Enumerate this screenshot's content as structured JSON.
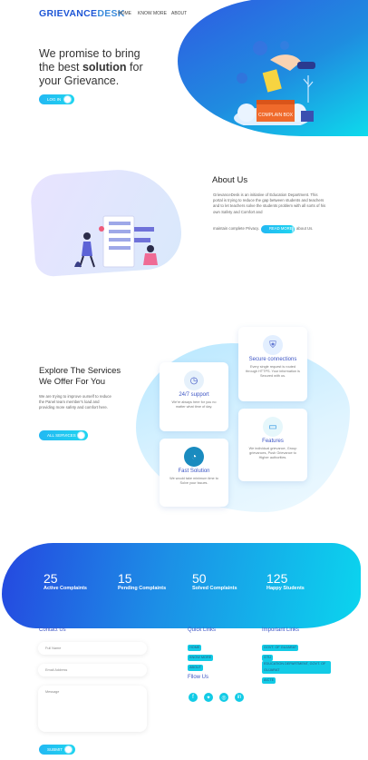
{
  "nav": {
    "logo_part1": "GRIEVANCE",
    "logo_part2": "DESK",
    "home": "HOME",
    "know_more": "KNOW MORE",
    "about": "ABOUT"
  },
  "hero": {
    "line1": "We promise to bring",
    "line2_pre": "the best ",
    "line2_bold": "solution",
    "line2_post": " for",
    "line3": "your Grievance.",
    "login": "LOG IN",
    "box_label": "COMPLAIN BOX"
  },
  "about": {
    "title": "About Us",
    "text": "GrievanceDesk is an initiative of Education Department. This portal is trying to reduce the gap between students and teachers and to let teachers solve the students problem with all sorts of his own Safety and Comfort and",
    "text2_pre": "maintain complete Privacy.",
    "read_more": "READ MORE",
    "text2_post": "about Us."
  },
  "services": {
    "title_line1": "Explore The Services",
    "title_line2": "We Offer For You",
    "desc": "We are trying to improve ourself to reduce the Panel team member's load and providing more safety and comfort here.",
    "all_services": "ALL SERVICES",
    "cards": [
      {
        "title": "Secure connections",
        "desc": "Every single request is routed through HTTPS. Your information is Secured with us."
      },
      {
        "title": "24/7 support",
        "desc": "We're always here for you no matter what time of day."
      },
      {
        "title": "Features",
        "desc": "We individual grievance, Group grievances, Push Grievance to Higher authorities."
      },
      {
        "title": "Fast Solution",
        "desc": "We would take minimum time to Solve your Issues."
      }
    ]
  },
  "stats": [
    {
      "number": "25",
      "label": "Active Complaints"
    },
    {
      "number": "15",
      "label": "Pending Complaints"
    },
    {
      "number": "50",
      "label": "Solved Complaints"
    },
    {
      "number": "125",
      "label": "Happy Students"
    }
  ],
  "footer": {
    "contact_title": "Contact Us",
    "full_name": "Full Name",
    "email": "Email Address",
    "message": "Message",
    "submit": "SUBMIT",
    "quick_title": "Quick Links",
    "quick_links": [
      "HOME",
      "KNOW MORE",
      "ABOUT"
    ],
    "important_title": "Important Links",
    "important_links": [
      "GOVT. OF GUJARAT",
      "GTU",
      "EDUCATION DEPARTMENT, GOVT. OF GUJARAT",
      "AICTE"
    ],
    "follow_title": "Fllow Us",
    "social_icons": [
      "facebook-icon",
      "twitter-icon",
      "instagram-icon",
      "linkedin-icon"
    ]
  }
}
